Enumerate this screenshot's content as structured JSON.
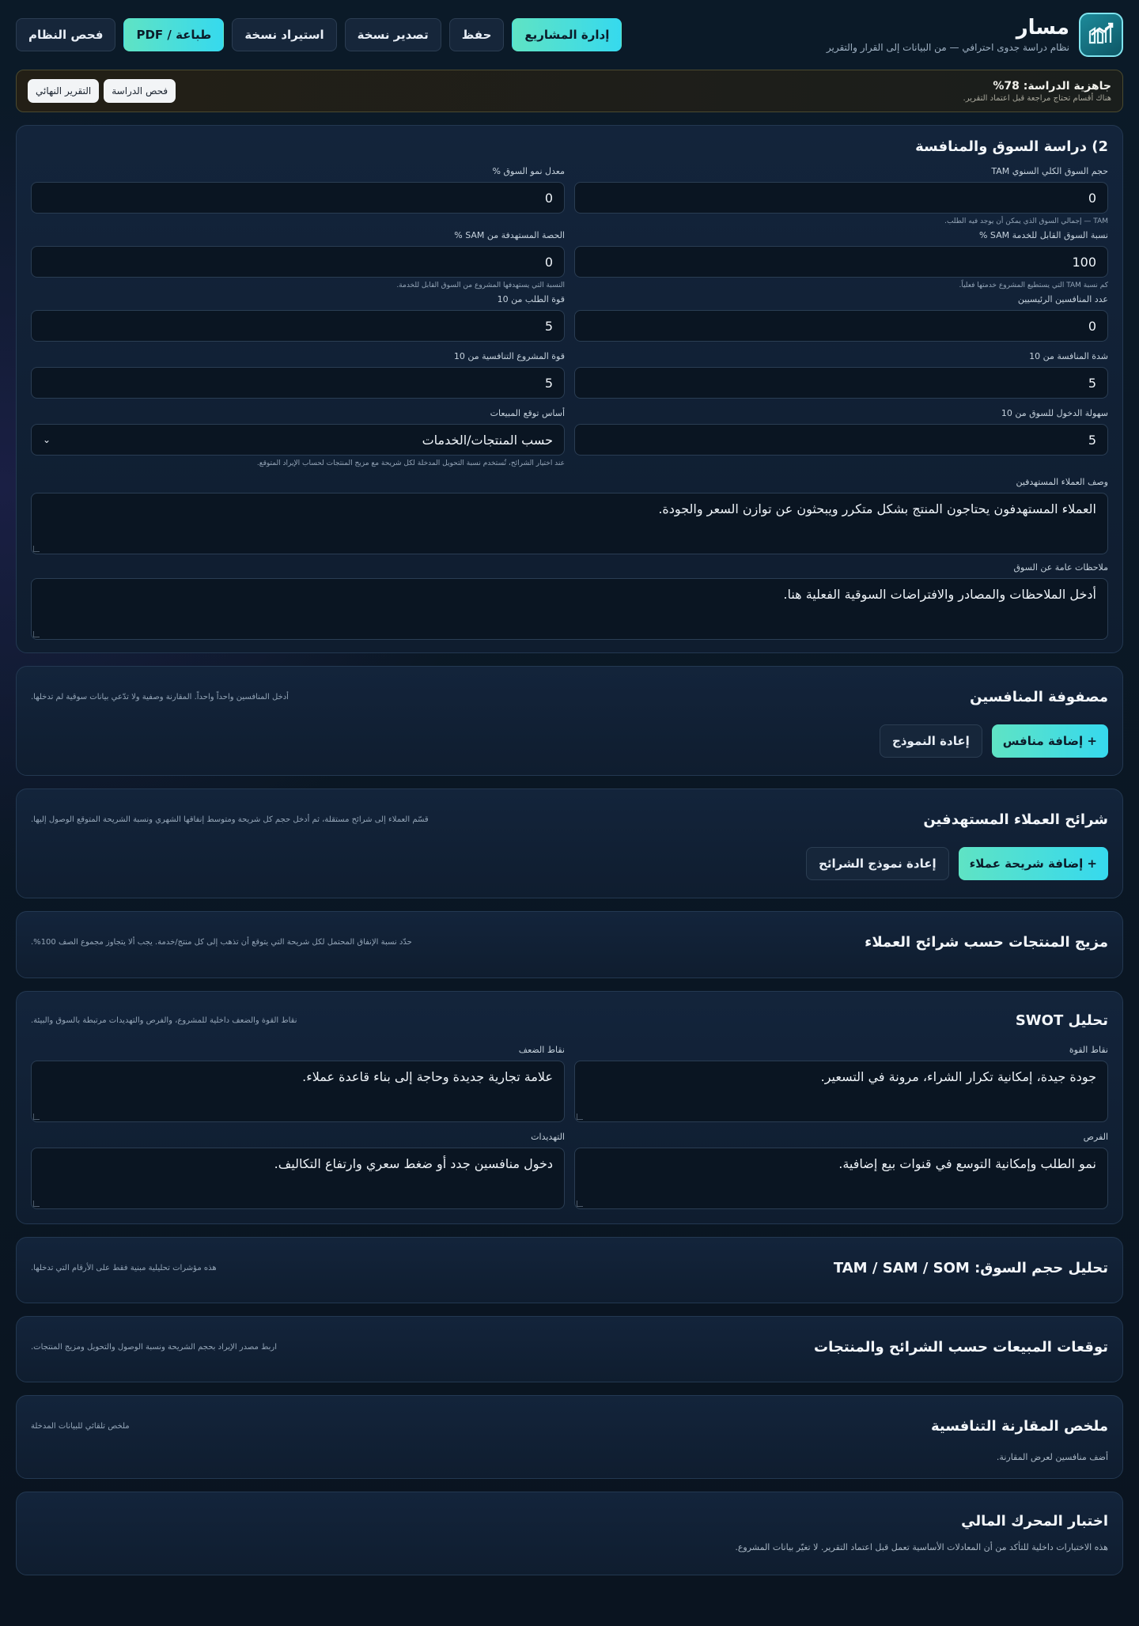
{
  "brand": {
    "title": "مسار",
    "subtitle": "نظام دراسة جدوى احترافي — من البيانات إلى القرار والتقرير"
  },
  "toolbar": {
    "manage": "إدارة المشاريع",
    "save": "حفظ",
    "export": "تصدير نسخة",
    "import": "استيراد نسخة",
    "print": "طباعة / PDF",
    "check": "فحص النظام"
  },
  "readiness": {
    "title": "جاهزية الدراسة: 78%",
    "subtitle": "هناك أقسام تحتاج مراجعة قبل اعتماد التقرير.",
    "check_study": "فحص الدراسة",
    "final_report": "التقرير النهائي"
  },
  "market": {
    "title": "2) دراسة السوق والمنافسة",
    "tam_label": "حجم السوق الكلي السنوي TAM",
    "tam_value": "0",
    "tam_hint": "TAM — إجمالي السوق الذي يمكن أن يوجد فيه الطلب.",
    "growth_label": "معدل نمو السوق %",
    "growth_value": "0",
    "sam_label": "نسبة السوق القابل للخدمة SAM %",
    "sam_value": "100",
    "sam_hint": "كم نسبة TAM التي يستطيع المشروع خدمتها فعلياً.",
    "share_label": "الحصة المستهدفة من SAM %",
    "share_value": "0",
    "share_hint": "النسبة التي يستهدفها المشروع من السوق القابل للخدمة.",
    "competitors_label": "عدد المنافسين الرئيسيين",
    "competitors_value": "0",
    "demand_label": "قوة الطلب من 10",
    "demand_value": "5",
    "intensity_label": "شدة المنافسة من 10",
    "intensity_value": "5",
    "strength_label": "قوة المشروع التنافسية من 10",
    "strength_value": "5",
    "entry_label": "سهولة الدخول للسوق من 10",
    "entry_value": "5",
    "basis_label": "أساس توقع المبيعات",
    "basis_value": "حسب المنتجات/الخدمات",
    "basis_hint": "عند اختيار الشرائح، تُستخدم نسبة التحويل المدخلة لكل شريحة مع مزيج المنتجات لحساب الإيراد المتوقع.",
    "customers_label": "وصف العملاء المستهدفين",
    "customers_value": "العملاء المستهدفون يحتاجون المنتج بشكل متكرر ويبحثون عن توازن السعر والجودة.",
    "notes_label": "ملاحظات عامة عن السوق",
    "notes_value": "أدخل الملاحظات والمصادر والافتراضات السوقية الفعلية هنا."
  },
  "competitors": {
    "title": "مصفوفة المنافسين",
    "note": "أدخل المنافسين واحداً واحداً. المقارنة وصفية ولا تدّعي بيانات سوقية لم تدخلها.",
    "add": "+ إضافة منافس",
    "reset": "إعادة النموذج"
  },
  "segments": {
    "title": "شرائح العملاء المستهدفين",
    "note": "قسّم العملاء إلى شرائح مستقلة، ثم أدخل حجم كل شريحة ومتوسط إنفاقها الشهري ونسبة الشريحة المتوقع الوصول إليها.",
    "add": "+ إضافة شريحة عملاء",
    "reset": "إعادة نموذج الشرائح"
  },
  "mix": {
    "title": "مزيج المنتجات حسب شرائح العملاء",
    "note": "حدّد نسبة الإنفاق المحتمل لكل شريحة التي يتوقع أن تذهب إلى كل منتج/خدمة. يجب ألا يتجاوز مجموع الصف 100%."
  },
  "swot": {
    "title": "تحليل SWOT",
    "note": "نقاط القوة والضعف داخلية للمشروع، والفرص والتهديدات مرتبطة بالسوق والبيئة.",
    "strengths_label": "نقاط القوة",
    "strengths_value": "جودة جيدة، إمكانية تكرار الشراء، مرونة في التسعير.",
    "weaknesses_label": "نقاط الضعف",
    "weaknesses_value": "علامة تجارية جديدة وحاجة إلى بناء قاعدة عملاء.",
    "opportunities_label": "الفرص",
    "opportunities_value": "نمو الطلب وإمكانية التوسع في قنوات بيع إضافية.",
    "threats_label": "التهديدات",
    "threats_value": "دخول منافسين جدد أو ضغط سعري وارتفاع التكاليف."
  },
  "size": {
    "title": "تحليل حجم السوق: TAM / SAM / SOM",
    "note": "هذه مؤشرات تحليلية مبنية فقط على الأرقام التي تدخلها."
  },
  "forecast": {
    "title": "توقعات المبيعات حسب الشرائح والمنتجات",
    "note": "اربط مصدر الإيراد بحجم الشريحة ونسبة الوصول والتحويل ومزيج المنتجات."
  },
  "summary": {
    "title": "ملخص المقارنة التنافسية",
    "note": "ملخص تلقائي للبيانات المدخلة",
    "empty": "أضف منافسين لعرض المقارنة."
  },
  "engine": {
    "title": "اختبار المحرك المالي",
    "note": "هذه الاختبارات داخلية للتأكد من أن المعادلات الأساسية تعمل قبل اعتماد التقرير. لا تغيّر بيانات المشروع."
  },
  "colors": {
    "accent_start": "#5fe3c4",
    "accent_end": "#36d9ee",
    "panel": "#13243b"
  }
}
